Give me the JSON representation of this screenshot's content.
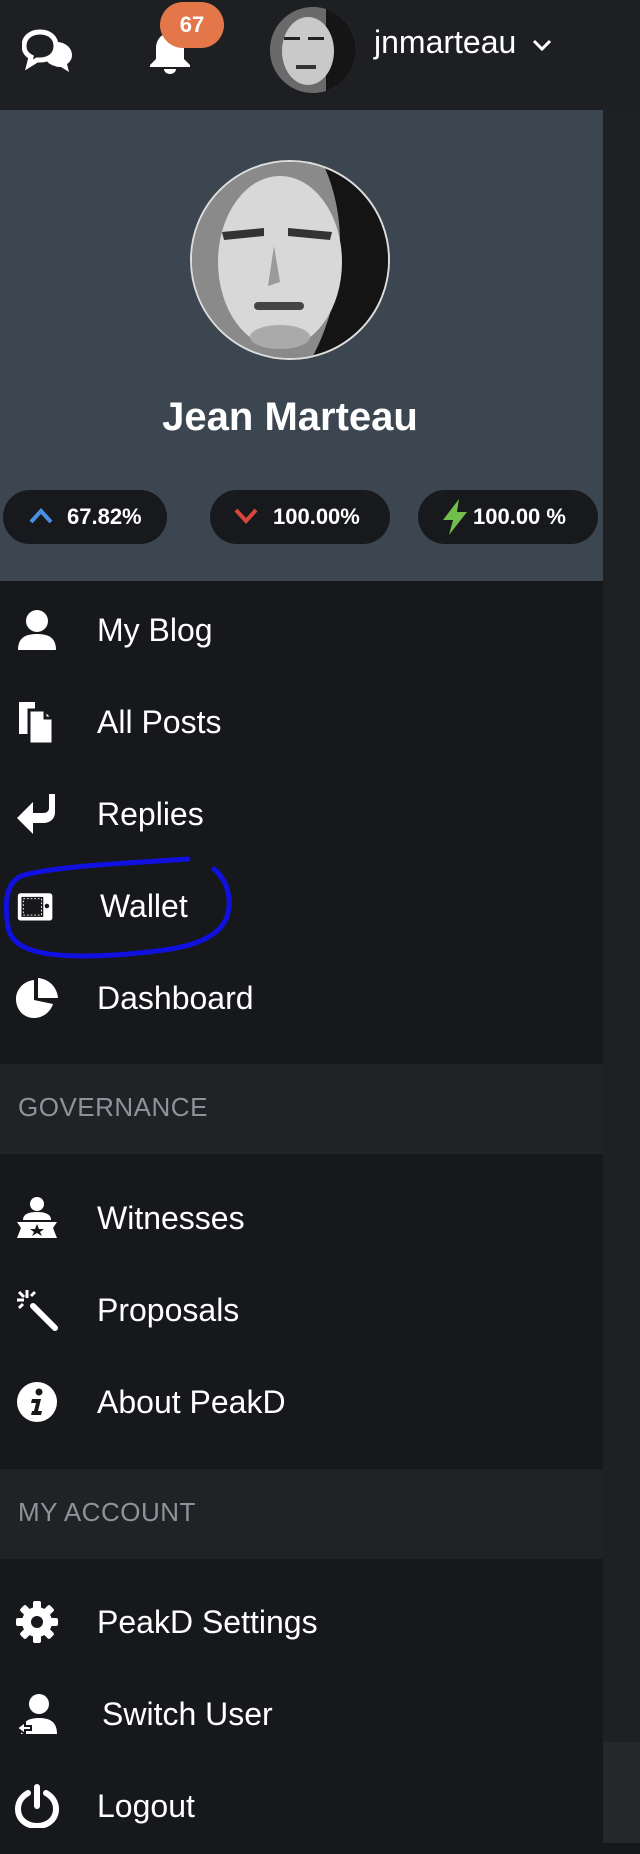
{
  "topbar": {
    "notification_count": "67",
    "username": "jnmarteau"
  },
  "profile": {
    "display_name": "Jean Marteau",
    "stats": {
      "upvote": "67.82%",
      "downvote": "100.00%",
      "resource_credits": "100.00 %"
    }
  },
  "menu": {
    "items": [
      {
        "label": "My Blog",
        "icon": "user-icon"
      },
      {
        "label": "All Posts",
        "icon": "documents-icon"
      },
      {
        "label": "Replies",
        "icon": "reply-icon"
      },
      {
        "label": "Wallet",
        "icon": "wallet-icon"
      },
      {
        "label": "Dashboard",
        "icon": "pie-chart-icon"
      }
    ]
  },
  "governance": {
    "header": "GOVERNANCE",
    "items": [
      {
        "label": "Witnesses",
        "icon": "witness-icon"
      },
      {
        "label": "Proposals",
        "icon": "magic-wand-icon"
      },
      {
        "label": "About PeakD",
        "icon": "info-icon"
      }
    ]
  },
  "account": {
    "header": "MY ACCOUNT",
    "items": [
      {
        "label": "PeakD Settings",
        "icon": "gear-icon"
      },
      {
        "label": "Switch User",
        "icon": "switch-user-icon"
      },
      {
        "label": "Logout",
        "icon": "power-icon"
      }
    ]
  },
  "colors": {
    "background": "#17181b",
    "profile_bg": "#3c4650",
    "badge": "#e3774a",
    "upvote": "#4a90e2",
    "downvote": "#d9463a",
    "rc": "#6fbf4a",
    "annotation": "#1010e0"
  }
}
